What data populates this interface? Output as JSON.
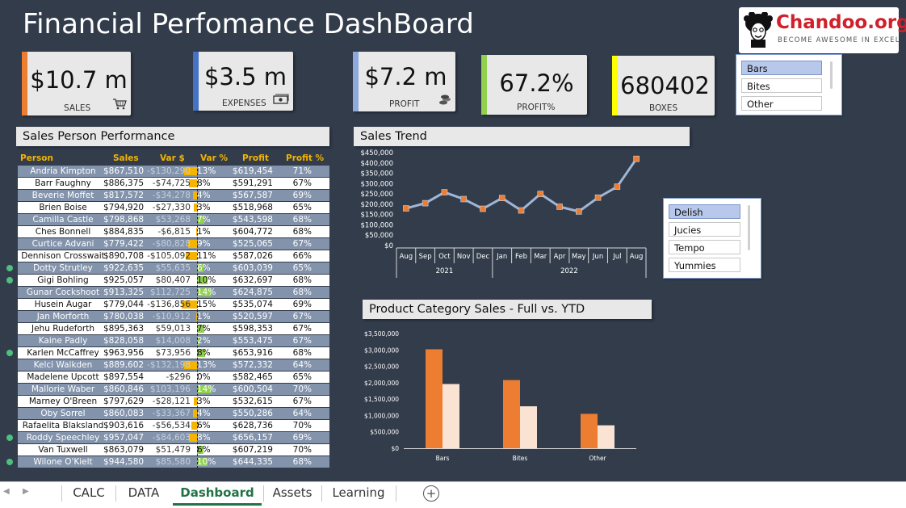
{
  "title": "Financial Perfomance DashBoard",
  "logo": {
    "name": "Chandoo.org",
    "tagline": "BECOME AWESOME IN EXCEL"
  },
  "kpis": [
    {
      "value": "$10.7 m",
      "label": "SALES",
      "icon": "shopping-cart-icon",
      "accent": "#ed7d31"
    },
    {
      "value": "$3.5 m",
      "label": "EXPENSES",
      "icon": "cash-icon",
      "accent": "#4472c4"
    },
    {
      "value": "$7.2 m",
      "label": "PROFIT",
      "icon": "coins-icon",
      "accent": "#8ea9db"
    },
    {
      "value": "67.2%",
      "label": "PROFIT%",
      "icon": "",
      "accent": "#92d050"
    },
    {
      "value": "680402",
      "label": "BOXES",
      "icon": "",
      "accent": "#ffff00"
    }
  ],
  "slicer_category": {
    "items": [
      {
        "label": "Bars",
        "selected": true
      },
      {
        "label": "Bites",
        "selected": false
      },
      {
        "label": "Other",
        "selected": false
      }
    ]
  },
  "slicer_product": {
    "items": [
      {
        "label": "Delish",
        "selected": true
      },
      {
        "label": "Jucies",
        "selected": false
      },
      {
        "label": "Tempo",
        "selected": false
      },
      {
        "label": "Yummies",
        "selected": false
      }
    ]
  },
  "sales_person": {
    "header": "Sales Person Performance",
    "columns": [
      "Person",
      "Sales",
      "Var $",
      "Var %",
      "Profit",
      "Profit %"
    ],
    "rows": [
      {
        "name": "Andria Kimpton",
        "sales": "$867,510",
        "var": "-$130,290",
        "varp": "13%",
        "varn": -13,
        "profit": "$619,454",
        "profitp": "71%",
        "flag": false
      },
      {
        "name": "Barr Faughny",
        "sales": "$886,375",
        "var": "-$74,725",
        "varp": "8%",
        "varn": -8,
        "profit": "$591,291",
        "profitp": "67%",
        "flag": false
      },
      {
        "name": "Beverie Moffet",
        "sales": "$817,572",
        "var": "-$34,278",
        "varp": "4%",
        "varn": -4,
        "profit": "$567,587",
        "profitp": "69%",
        "flag": false
      },
      {
        "name": "Brien Boise",
        "sales": "$794,920",
        "var": "-$27,330",
        "varp": "3%",
        "varn": -3,
        "profit": "$518,968",
        "profitp": "65%",
        "flag": false
      },
      {
        "name": "Camilla Castle",
        "sales": "$798,868",
        "var": "$53,268",
        "varp": "7%",
        "varn": 7,
        "profit": "$543,598",
        "profitp": "68%",
        "flag": false
      },
      {
        "name": "Ches Bonnell",
        "sales": "$884,835",
        "var": "-$6,815",
        "varp": "1%",
        "varn": -1,
        "profit": "$604,772",
        "profitp": "68%",
        "flag": false
      },
      {
        "name": "Curtice Advani",
        "sales": "$779,422",
        "var": "-$80,828",
        "varp": "9%",
        "varn": -9,
        "profit": "$525,065",
        "profitp": "67%",
        "flag": false
      },
      {
        "name": "Dennison Crosswait",
        "sales": "$890,708",
        "var": "-$105,092",
        "varp": "11%",
        "varn": -11,
        "profit": "$587,026",
        "profitp": "66%",
        "flag": false
      },
      {
        "name": "Dotty Strutley",
        "sales": "$922,635",
        "var": "$55,635",
        "varp": "6%",
        "varn": 6,
        "profit": "$603,039",
        "profitp": "65%",
        "flag": true
      },
      {
        "name": "Gigi Bohling",
        "sales": "$925,057",
        "var": "$80,407",
        "varp": "10%",
        "varn": 10,
        "profit": "$632,697",
        "profitp": "68%",
        "flag": true
      },
      {
        "name": "Gunar Cockshoot",
        "sales": "$913,325",
        "var": "$112,725",
        "varp": "14%",
        "varn": 14,
        "profit": "$624,875",
        "profitp": "68%",
        "flag": false
      },
      {
        "name": "Husein Augar",
        "sales": "$779,044",
        "var": "-$136,856",
        "varp": "15%",
        "varn": -15,
        "profit": "$535,074",
        "profitp": "69%",
        "flag": false
      },
      {
        "name": "Jan Morforth",
        "sales": "$780,038",
        "var": "-$10,912",
        "varp": "1%",
        "varn": -1,
        "profit": "$520,597",
        "profitp": "67%",
        "flag": false
      },
      {
        "name": "Jehu Rudeforth",
        "sales": "$895,363",
        "var": "$59,013",
        "varp": "7%",
        "varn": 7,
        "profit": "$598,353",
        "profitp": "67%",
        "flag": false
      },
      {
        "name": "Kaine Padly",
        "sales": "$828,058",
        "var": "$14,008",
        "varp": "2%",
        "varn": 2,
        "profit": "$553,475",
        "profitp": "67%",
        "flag": false
      },
      {
        "name": "Karlen McCaffrey",
        "sales": "$963,956",
        "var": "$73,956",
        "varp": "8%",
        "varn": 8,
        "profit": "$653,916",
        "profitp": "68%",
        "flag": true
      },
      {
        "name": "Kelci Walkden",
        "sales": "$889,602",
        "var": "-$132,198",
        "varp": "13%",
        "varn": -13,
        "profit": "$572,332",
        "profitp": "64%",
        "flag": false
      },
      {
        "name": "Madelene Upcott",
        "sales": "$897,554",
        "var": "-$296",
        "varp": "0%",
        "varn": 0,
        "profit": "$582,465",
        "profitp": "65%",
        "flag": false
      },
      {
        "name": "Mallorie Waber",
        "sales": "$860,846",
        "var": "$103,196",
        "varp": "14%",
        "varn": 14,
        "profit": "$600,504",
        "profitp": "70%",
        "flag": false
      },
      {
        "name": "Marney O'Breen",
        "sales": "$797,629",
        "var": "-$28,121",
        "varp": "3%",
        "varn": -3,
        "profit": "$532,615",
        "profitp": "67%",
        "flag": false
      },
      {
        "name": "Oby Sorrel",
        "sales": "$860,083",
        "var": "-$33,367",
        "varp": "4%",
        "varn": -4,
        "profit": "$550,286",
        "profitp": "64%",
        "flag": false
      },
      {
        "name": "Rafaelita Blaksland",
        "sales": "$903,616",
        "var": "-$56,534",
        "varp": "6%",
        "varn": -6,
        "profit": "$628,736",
        "profitp": "70%",
        "flag": false
      },
      {
        "name": "Roddy Speechley",
        "sales": "$957,047",
        "var": "-$84,603",
        "varp": "8%",
        "varn": -8,
        "profit": "$656,157",
        "profitp": "69%",
        "flag": true
      },
      {
        "name": "Van Tuxwell",
        "sales": "$863,079",
        "var": "$51,479",
        "varp": "6%",
        "varn": 6,
        "profit": "$607,219",
        "profitp": "70%",
        "flag": false
      },
      {
        "name": "Wilone O'Kielt",
        "sales": "$944,580",
        "var": "$85,580",
        "varp": "10%",
        "varn": 10,
        "profit": "$644,335",
        "profitp": "68%",
        "flag": true
      }
    ]
  },
  "chart_data": [
    {
      "type": "line",
      "title": "Sales Trend",
      "x": [
        "Aug",
        "Sep",
        "Oct",
        "Nov",
        "Dec",
        "Jan",
        "Feb",
        "Mar",
        "Apr",
        "May",
        "Jun",
        "Jul",
        "Aug"
      ],
      "x_groups": [
        {
          "label": "2021",
          "count": 5
        },
        {
          "label": "2022",
          "count": 8
        }
      ],
      "values": [
        180000,
        205000,
        258000,
        225000,
        178000,
        230000,
        170000,
        250000,
        188000,
        165000,
        232000,
        285000,
        420000
      ],
      "yticks": [
        "$0",
        "$50,000",
        "$100,000",
        "$150,000",
        "$200,000",
        "$250,000",
        "$300,000",
        "$350,000",
        "$400,000",
        "$450,000"
      ],
      "ylim": [
        0,
        450000
      ],
      "line_color": "#9fb6d6",
      "marker_color": "#ed7d31"
    },
    {
      "type": "bar",
      "title": "Product Category Sales - Full vs. YTD",
      "categories": [
        "Bars",
        "Bites",
        "Other"
      ],
      "series": [
        {
          "values": [
            3020000,
            2080000,
            1050000
          ],
          "color": "#ed7d31"
        },
        {
          "values": [
            1960000,
            1280000,
            700000
          ],
          "color": "#fbe3d4"
        }
      ],
      "yticks": [
        "$0",
        "$500,000",
        "$1,000,000",
        "$1,500,000",
        "$2,000,000",
        "$2,500,000",
        "$3,000,000",
        "$3,500,000"
      ],
      "ylim": [
        0,
        3500000
      ]
    }
  ],
  "tabs": [
    {
      "label": "CALC",
      "active": false
    },
    {
      "label": "DATA",
      "active": false
    },
    {
      "label": "Dashboard",
      "active": true
    },
    {
      "label": "Assets",
      "active": false
    },
    {
      "label": "Learning",
      "active": false
    }
  ]
}
